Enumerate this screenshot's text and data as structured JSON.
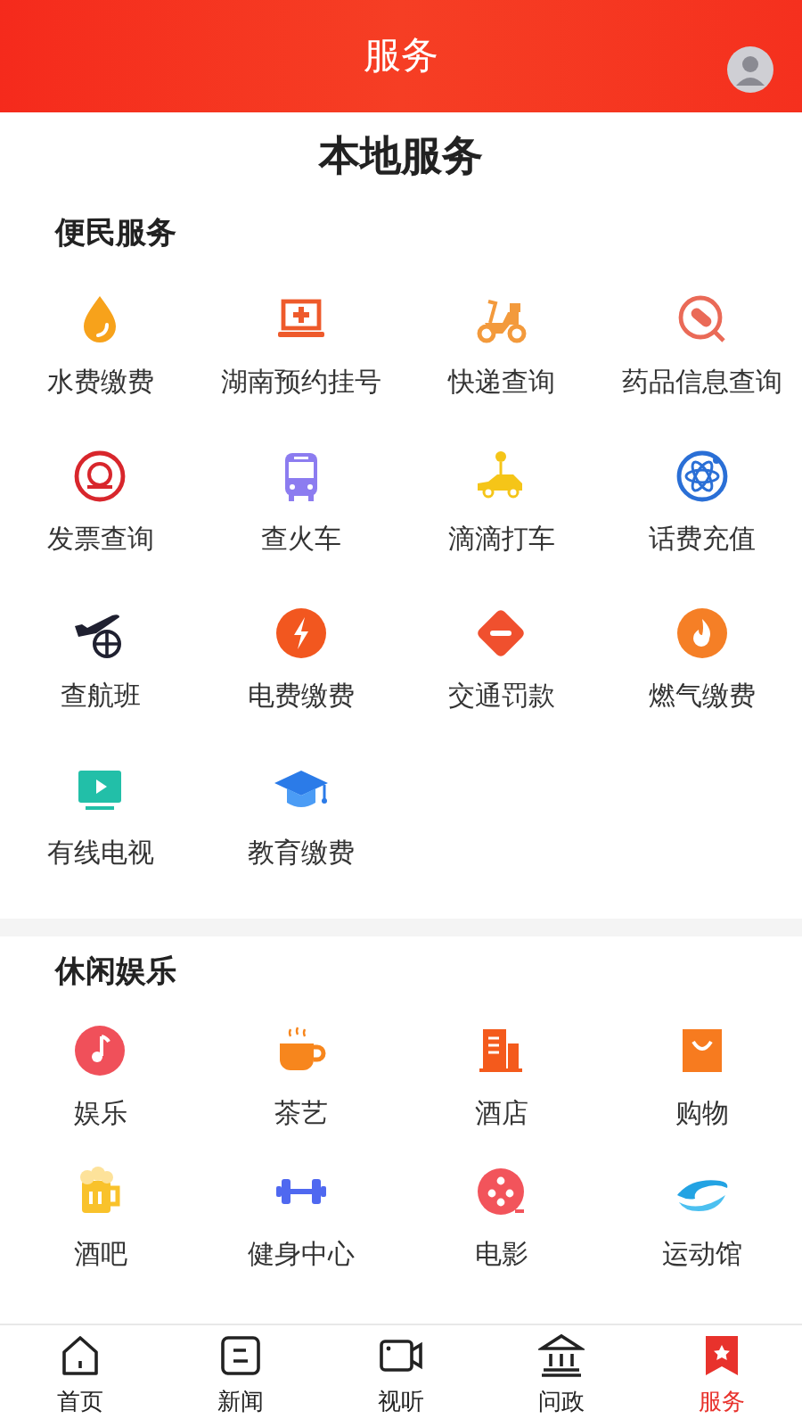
{
  "header": {
    "title": "服务"
  },
  "page_title": "本地服务",
  "sections": [
    {
      "title": "便民服务",
      "items": [
        {
          "label": "水费缴费"
        },
        {
          "label": "湖南预约挂号"
        },
        {
          "label": "快递查询"
        },
        {
          "label": "药品信息查询"
        },
        {
          "label": "发票查询"
        },
        {
          "label": "查火车"
        },
        {
          "label": "滴滴打车"
        },
        {
          "label": "话费充值"
        },
        {
          "label": "查航班"
        },
        {
          "label": "电费缴费"
        },
        {
          "label": "交通罚款"
        },
        {
          "label": "燃气缴费"
        },
        {
          "label": "有线电视"
        },
        {
          "label": "教育缴费"
        }
      ]
    },
    {
      "title": "休闲娱乐",
      "items": [
        {
          "label": "娱乐"
        },
        {
          "label": "茶艺"
        },
        {
          "label": "酒店"
        },
        {
          "label": "购物"
        },
        {
          "label": "酒吧"
        },
        {
          "label": "健身中心"
        },
        {
          "label": "电影"
        },
        {
          "label": "运动馆"
        }
      ]
    }
  ],
  "tab_bar": [
    {
      "label": "首页",
      "selected": false
    },
    {
      "label": "新闻",
      "selected": false
    },
    {
      "label": "视听",
      "selected": false
    },
    {
      "label": "问政",
      "selected": false
    },
    {
      "label": "服务",
      "selected": true
    }
  ]
}
